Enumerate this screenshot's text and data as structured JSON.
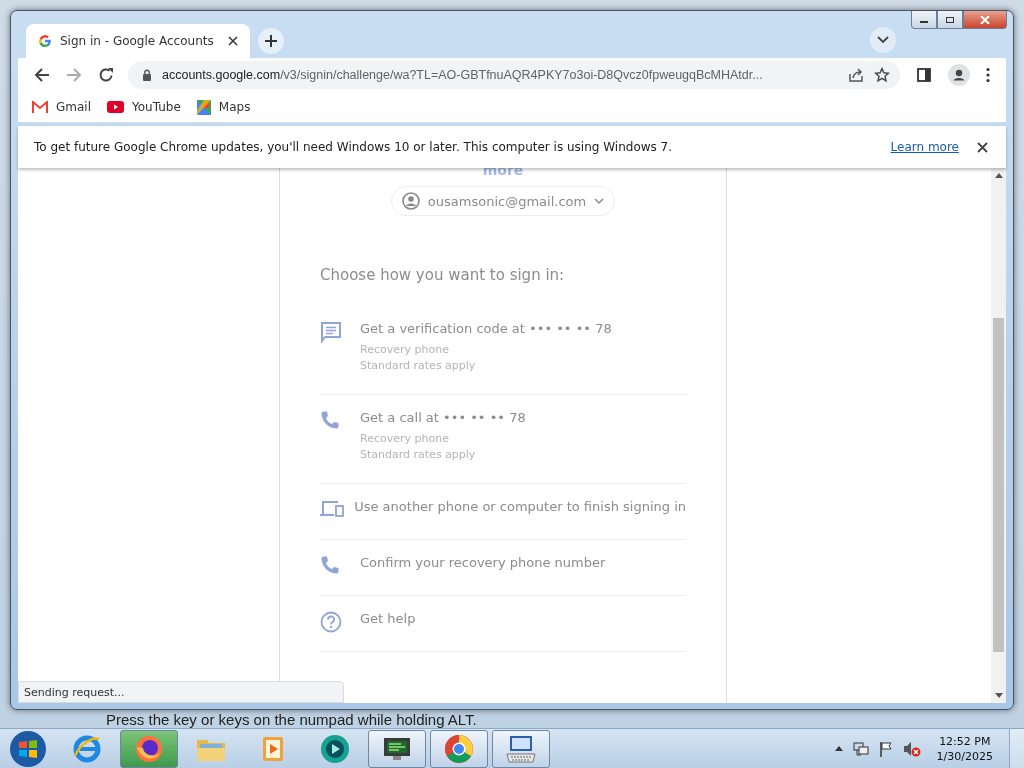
{
  "browser": {
    "tabs": [
      {
        "title": "Sign in - Google Accounts",
        "selected": true
      }
    ],
    "address": {
      "host": "accounts.google.com",
      "path": "/v3/signin/challenge/wa?TL=AO-GBTfnuAQR4PKY7o3oi-D8Qvcz0fpweugqBcMHAtdr..."
    },
    "bookmarks": [
      {
        "label": "Gmail",
        "kind": "mail"
      },
      {
        "label": "YouTube",
        "kind": "video"
      },
      {
        "label": "Maps",
        "kind": "map"
      }
    ],
    "infobar": {
      "message": "To get future Google Chrome updates, you'll need Windows 10 or later. This computer is using Windows 7.",
      "link": "Learn more"
    },
    "status": "Sending request..."
  },
  "page": {
    "more_link": "more",
    "account": "ousamsonic@gmail.com",
    "heading": "Choose how you want to sign in:",
    "options": [
      {
        "kind": "sms",
        "title": "Get a verification code at ••• •• •• 78",
        "details": [
          "Recovery phone",
          "Standard rates apply"
        ]
      },
      {
        "kind": "call",
        "title": "Get a call at ••• •• •• 78",
        "details": [
          "Recovery phone",
          "Standard rates apply"
        ]
      },
      {
        "kind": "devices",
        "title": "Use another phone or computer to finish signing in"
      },
      {
        "kind": "call",
        "title": "Confirm your recovery phone number"
      },
      {
        "kind": "help",
        "title": "Get help"
      }
    ]
  },
  "desktop_text": "Press the key or keys on the numpad while holding ALT.",
  "taskbar": {
    "apps": [
      {
        "kind": "ie",
        "running": false,
        "highlighted": false
      },
      {
        "kind": "firefox",
        "running": true,
        "highlighted": true
      },
      {
        "kind": "explorer",
        "running": false,
        "highlighted": false
      },
      {
        "kind": "media",
        "running": false,
        "highlighted": false
      },
      {
        "kind": "orb",
        "running": false,
        "highlighted": false
      },
      {
        "kind": "monitor",
        "running": true,
        "highlighted": false
      },
      {
        "kind": "chrome",
        "running": true,
        "highlighted": false
      },
      {
        "kind": "keyboard",
        "running": true,
        "highlighted": false
      }
    ],
    "time": "12:52 PM",
    "date": "1/30/2025"
  }
}
